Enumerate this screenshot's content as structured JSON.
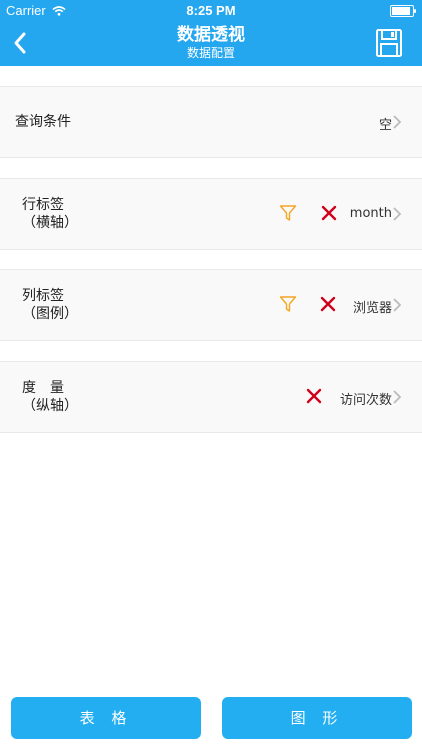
{
  "status_bar": {
    "carrier": "Carrier",
    "time": "8:25 PM"
  },
  "header": {
    "title": "数据透视",
    "subtitle": "数据配置",
    "back_icon": "chevron-left-icon",
    "save_icon": "save-icon"
  },
  "rows": {
    "query": {
      "label": "查询条件",
      "value": "空"
    },
    "row_label": {
      "label_line1": "行标签",
      "label_line2": "（横轴）",
      "value": "month"
    },
    "column_label": {
      "label_line1": "列标签",
      "label_line2": "（图例）",
      "value": "浏览器"
    },
    "measure": {
      "label_line1": "度　量",
      "label_line2": "（纵轴）",
      "value": "访问次数"
    }
  },
  "buttons": {
    "table": "表 格",
    "chart": "图 形"
  },
  "colors": {
    "accent": "#24a7ef",
    "filter": "#f5a623",
    "delete": "#d0021b"
  }
}
